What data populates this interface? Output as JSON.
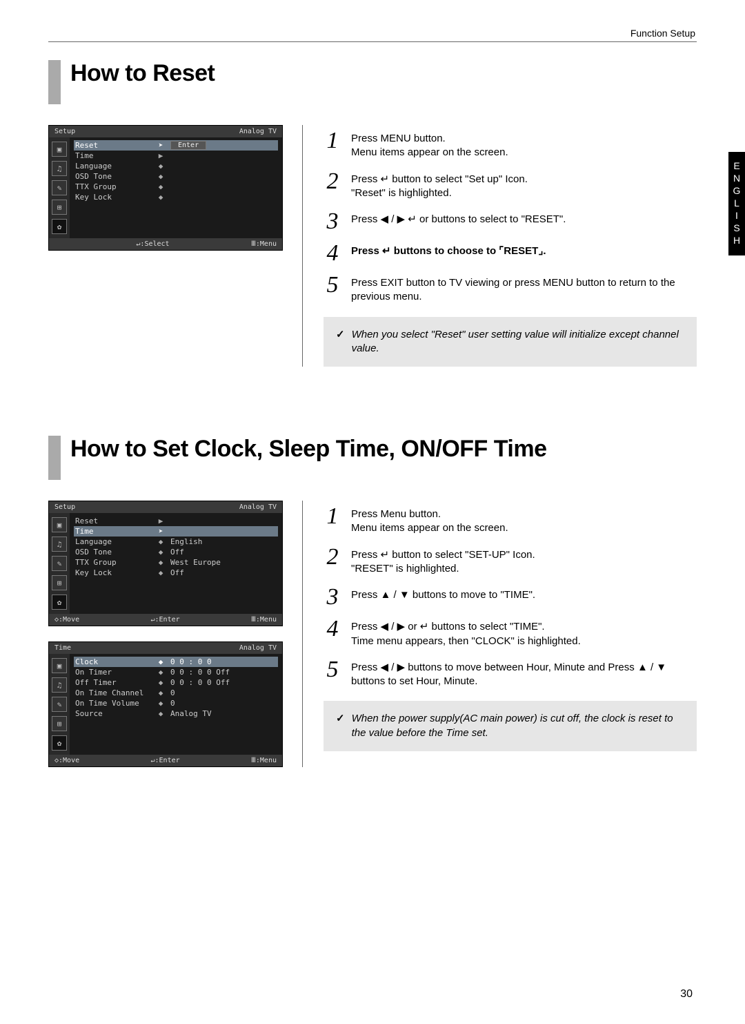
{
  "header_label": "Function Setup",
  "language_tab": "ENGLISH",
  "page_number": "30",
  "section1": {
    "title": "How to Reset",
    "osd": {
      "title_left": "Setup",
      "title_right": "Analog TV",
      "enter_btn": "Enter",
      "rows": [
        {
          "label": "Reset",
          "ind": "➤",
          "val": "",
          "sel": true,
          "btn": true
        },
        {
          "label": "Time",
          "ind": "▶",
          "val": ""
        },
        {
          "label": "Language",
          "ind": "◆",
          "val": ""
        },
        {
          "label": "OSD Tone",
          "ind": "◆",
          "val": ""
        },
        {
          "label": "TTX Group",
          "ind": "◆",
          "val": ""
        },
        {
          "label": "Key Lock",
          "ind": "◆",
          "val": ""
        }
      ],
      "footer_mid": "↵:Select",
      "footer_right": "Ⅲ:Menu"
    },
    "steps": [
      {
        "n": "1",
        "html": "Press MENU button.<br>Menu items appear on the screen."
      },
      {
        "n": "2",
        "html": "Press <span class='icon'>↵</span> button to select \"Set up\" Icon.<br>\"Reset\" is highlighted."
      },
      {
        "n": "3",
        "html": "Press  ◀ / ▶ <span class='icon'>↵</span>  or buttons to select to \"RESET\"."
      },
      {
        "n": "4",
        "html": "<b>Press <span class='icon'>↵</span> buttons to choose to ⌜RESET⌟.</b>"
      },
      {
        "n": "5",
        "html": "Press EXIT button to TV viewing or press MENU button to return to the previous menu."
      }
    ],
    "note": "When you select \"Reset\" user setting value will initialize except channel value."
  },
  "section2": {
    "title": "How to Set Clock, Sleep Time, ON/OFF Time",
    "osd_setup": {
      "title_left": "Setup",
      "title_right": "Analog TV",
      "rows": [
        {
          "label": "Reset",
          "ind": "▶",
          "val": ""
        },
        {
          "label": "Time",
          "ind": "➤",
          "val": "",
          "sel": true
        },
        {
          "label": "Language",
          "ind": "◆",
          "val": "English"
        },
        {
          "label": "OSD Tone",
          "ind": "◆",
          "val": "Off"
        },
        {
          "label": "TTX Group",
          "ind": "◆",
          "val": "West Europe"
        },
        {
          "label": "Key Lock",
          "ind": "◆",
          "val": "Off"
        }
      ],
      "footer_left": "◇:Move",
      "footer_mid": "↵:Enter",
      "footer_right": "Ⅲ:Menu"
    },
    "osd_time": {
      "title_left": "Time",
      "title_right": "Analog TV",
      "rows": [
        {
          "label": "Clock",
          "ind": "◆",
          "val": "0 0  :  0 0",
          "sel": true
        },
        {
          "label": "On Timer",
          "ind": "◆",
          "val": "0 0  :  0 0  Off"
        },
        {
          "label": "Off Timer",
          "ind": "◆",
          "val": "0 0  :  0 0  Off"
        },
        {
          "label": "On Time Channel",
          "ind": "◆",
          "val": "0"
        },
        {
          "label": "On Time Volume",
          "ind": "◆",
          "val": "0"
        },
        {
          "label": "Source",
          "ind": "◆",
          "val": "Analog TV"
        }
      ],
      "footer_left": "◇:Move",
      "footer_mid": "↵:Enter",
      "footer_right": "Ⅲ:Menu"
    },
    "steps": [
      {
        "n": "1",
        "html": "Press Menu button.<br>Menu items appear on the screen."
      },
      {
        "n": "2",
        "html": "Press <span class='icon'>↵</span> button to select \"SET-UP\" Icon.<br>\"RESET\" is highlighted."
      },
      {
        "n": "3",
        "html": "Press  ▲ / ▼ buttons to move to \"TIME\"."
      },
      {
        "n": "4",
        "html": "Press  ◀ / ▶ or <span class='icon'>↵</span> buttons to select \"TIME\".<br>Time menu appears, then \"CLOCK\" is highlighted."
      },
      {
        "n": "5",
        "html": "Press  ◀ / ▶ buttons to move between Hour, Minute and Press   ▲ / ▼ buttons to set Hour, Minute."
      }
    ],
    "note": "When the power supply(AC main power) is cut off, the clock is reset to the value before the Time set."
  }
}
